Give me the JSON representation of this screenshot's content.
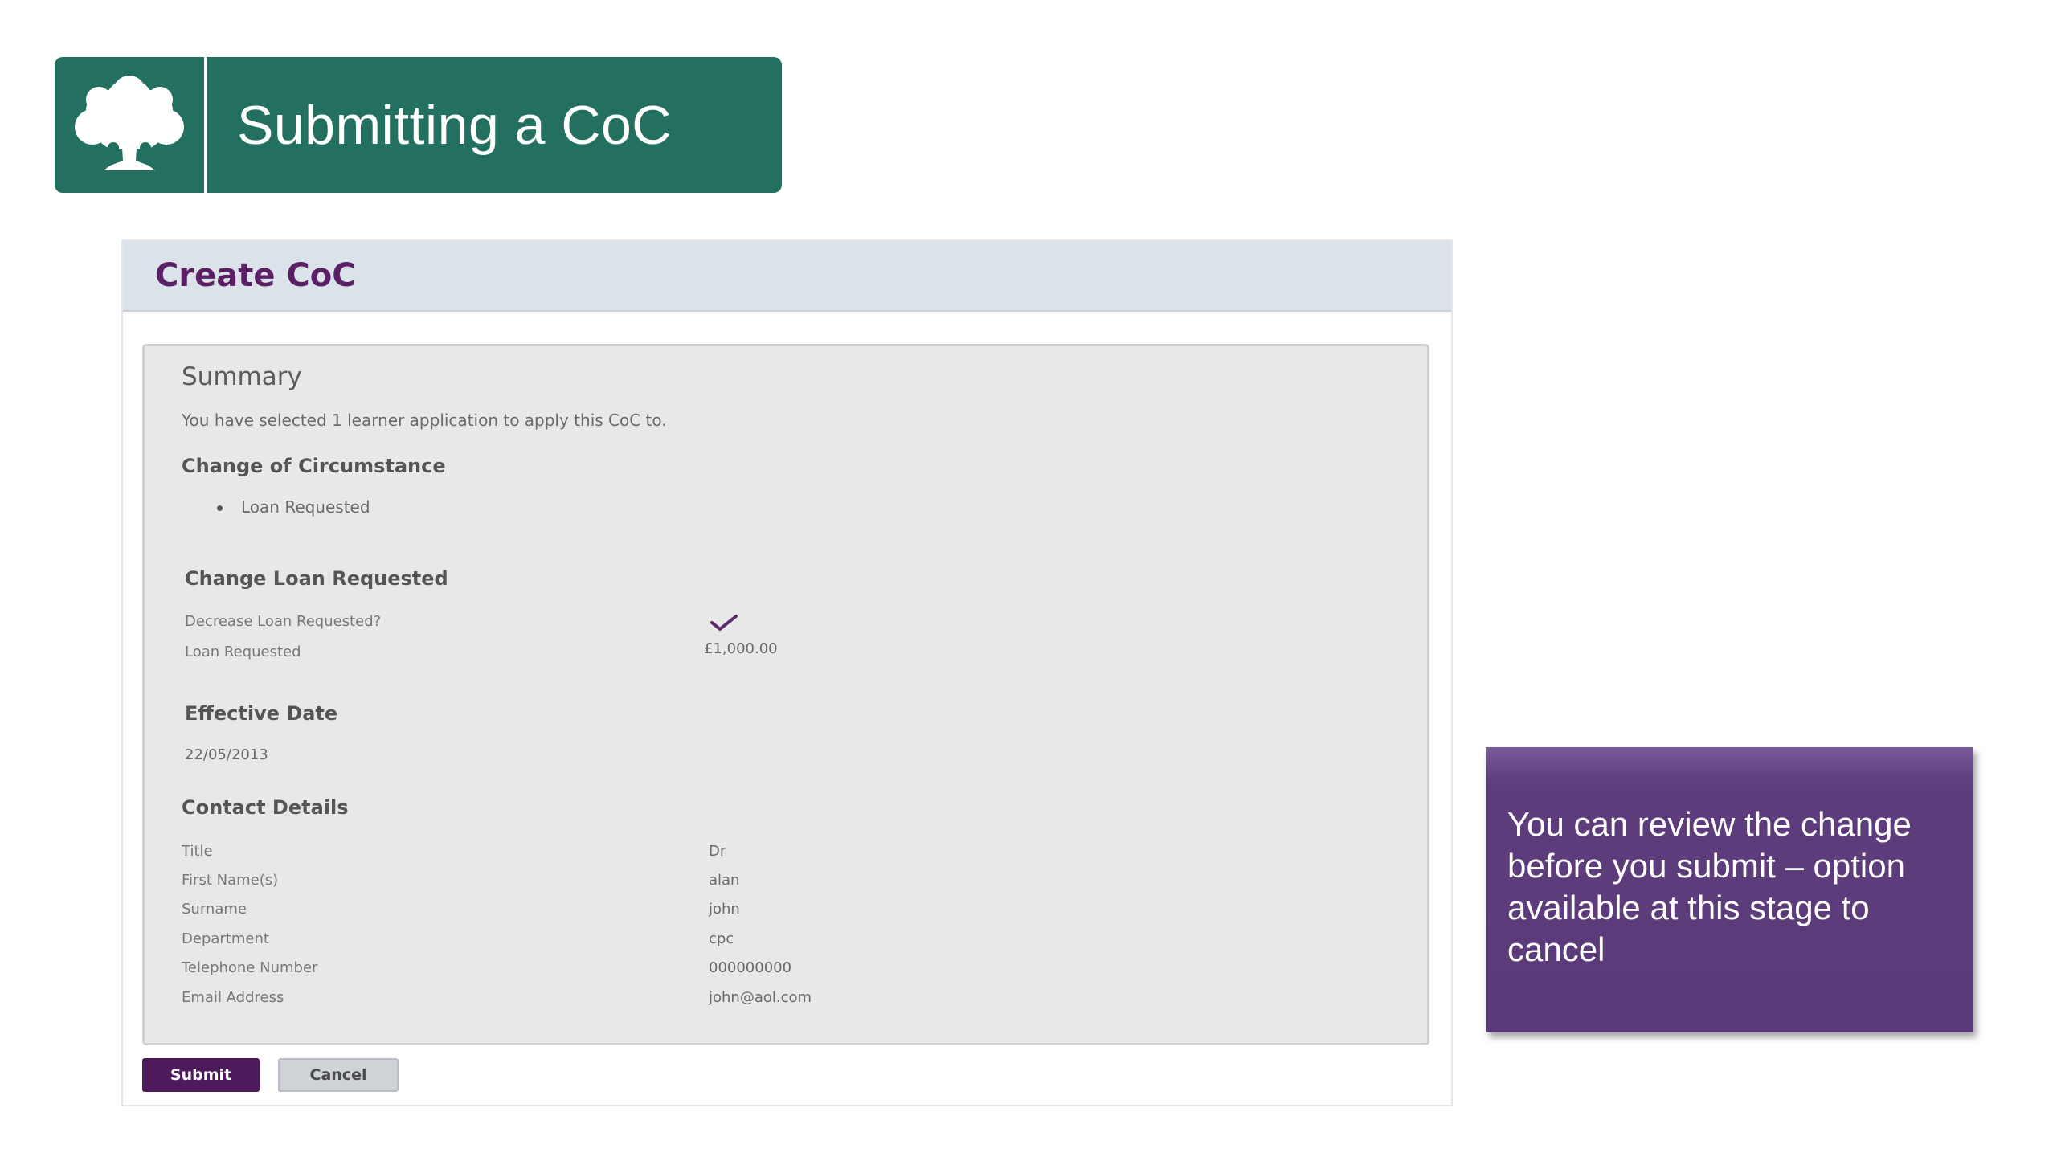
{
  "banner": {
    "title": "Submitting a CoC",
    "logo_icon": "oak-tree-icon"
  },
  "form": {
    "header_title": "Create CoC",
    "summary": {
      "title": "Summary",
      "intro": "You have selected 1 learner application to apply this CoC to.",
      "coc_heading": "Change of Circumstance",
      "coc_items": [
        "Loan Requested"
      ]
    },
    "loan": {
      "heading": "Change Loan Requested",
      "decrease_label": "Decrease Loan Requested?",
      "decrease_icon": "checkmark-icon",
      "loan_label": "Loan Requested",
      "loan_value": "£1,000.00"
    },
    "effective": {
      "heading": "Effective Date",
      "date": "22/05/2013"
    },
    "contact": {
      "heading": "Contact Details",
      "rows": [
        {
          "label": "Title",
          "value": "Dr"
        },
        {
          "label": "First Name(s)",
          "value": "alan"
        },
        {
          "label": "Surname",
          "value": "john"
        },
        {
          "label": "Department",
          "value": "cpc"
        },
        {
          "label": "Telephone Number",
          "value": "000000000"
        },
        {
          "label": "Email Address",
          "value": "john@aol.com"
        }
      ]
    },
    "buttons": {
      "submit": "Submit",
      "cancel": "Cancel"
    }
  },
  "callout": {
    "text": "You can review the change before you submit – option available at this stage to cancel"
  },
  "colors": {
    "banner_green": "#237060",
    "brand_purple": "#5a1f64",
    "callout_purple": "#5a3a78"
  }
}
